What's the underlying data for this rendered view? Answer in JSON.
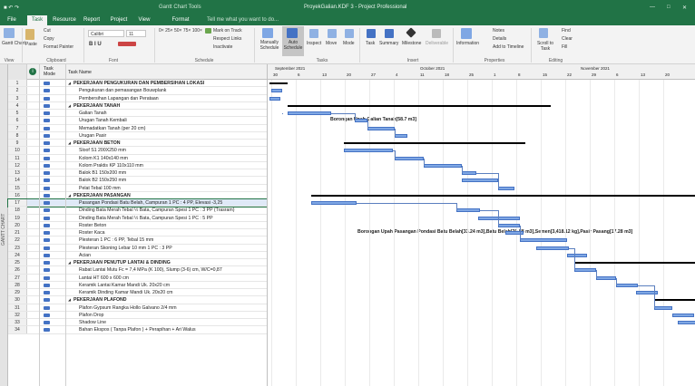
{
  "window": {
    "title": "ProyekGalian.KDF 3 - Project Professional",
    "context": "Gantt Chart Tools",
    "tell_me": "Tell me what you want to do..."
  },
  "tabs": [
    "File",
    "Task",
    "Resource",
    "Report",
    "Project",
    "View",
    "Format"
  ],
  "ribbon": {
    "view": {
      "gantt": "Gantt Chart",
      "group": "View"
    },
    "clipboard": {
      "paste": "Paste",
      "cut": "Cut",
      "copy": "Copy",
      "painter": "Format Painter",
      "group": "Clipboard"
    },
    "font": {
      "name": "Calibri",
      "size": "11",
      "group": "Font"
    },
    "schedule": {
      "track": "Mark on Track",
      "respect": "Respect Links",
      "inactivate": "Inactivate",
      "group": "Schedule"
    },
    "tasks": {
      "manual": "Manually Schedule",
      "auto": "Auto Schedule",
      "inspect": "Inspect",
      "move": "Move",
      "mode": "Mode",
      "group": "Tasks"
    },
    "insert": {
      "task": "Task",
      "summary": "Summary",
      "milestone": "Milestone",
      "deliverable": "Deliverable",
      "group": "Insert"
    },
    "properties": {
      "information": "Information",
      "notes": "Notes",
      "details": "Details",
      "timeline": "Add to Timeline",
      "group": "Properties"
    },
    "editing": {
      "scroll": "Scroll to Task",
      "find": "Find",
      "clear": "Clear",
      "fill": "Fill",
      "group": "Editing"
    }
  },
  "sidebar": {
    "label": "GANTT CHART"
  },
  "columns": {
    "mode": "Task Mode",
    "name": "Task Name"
  },
  "timescale": {
    "months": [
      "September 2021",
      "October 2021",
      "November 2021"
    ],
    "days": [
      "30",
      "6",
      "13",
      "20",
      "27",
      "4",
      "11",
      "18",
      "25",
      "1",
      "8",
      "15",
      "22",
      "29",
      "6",
      "13",
      "20"
    ]
  },
  "rows": [
    {
      "n": "1",
      "name": "PEKERJAAN PENGUKURAN DAN PEMBERSIHAN LOKASI",
      "sum": true
    },
    {
      "n": "2",
      "name": "Pengukuran dan pemasangan Bouwplank",
      "sum": false
    },
    {
      "n": "3",
      "name": "Pembersihan Lapangan dan Perataan",
      "sum": false
    },
    {
      "n": "4",
      "name": "PEKERJAAN TANAH",
      "sum": true
    },
    {
      "n": "5",
      "name": "Galian Tanah",
      "sum": false
    },
    {
      "n": "6",
      "name": "Urugan Tanah Kembali",
      "sum": false
    },
    {
      "n": "7",
      "name": "Memadatkan Tanah (per 20 cm)",
      "sum": false
    },
    {
      "n": "8",
      "name": "Urugan Pasir",
      "sum": false
    },
    {
      "n": "9",
      "name": "PEKERJAAN BETON",
      "sum": true
    },
    {
      "n": "10",
      "name": "Sloof S1 200X250 mm",
      "sum": false
    },
    {
      "n": "11",
      "name": "Kolom K1 140x140 mm",
      "sum": false
    },
    {
      "n": "12",
      "name": "Kolom Praktis KP 110x110 mm",
      "sum": false
    },
    {
      "n": "13",
      "name": "Balok B1 150x200 mm",
      "sum": false
    },
    {
      "n": "14",
      "name": "Balok B2 150x250 mm",
      "sum": false
    },
    {
      "n": "15",
      "name": "Pelat Tebal 100 mm",
      "sum": false
    },
    {
      "n": "16",
      "name": "PEKERJAAN PASANGAN",
      "sum": true
    },
    {
      "n": "17",
      "name": "Pasangan Pondasi Batu Belah, Campuran 1 PC : 4 PP, Elevasi -3,25",
      "sum": false
    },
    {
      "n": "18",
      "name": "Dinding Bata Merah Tebal ½ Bata, Campuran Spesi 1 PC : 3 PP (Trasram)",
      "sum": false
    },
    {
      "n": "19",
      "name": "Dinding Bata Merah Tebal ½ Bata, Campuran Spesi 1 PC : 5 PP",
      "sum": false
    },
    {
      "n": "20",
      "name": "Roster Beton",
      "sum": false
    },
    {
      "n": "21",
      "name": "Roster Kaca",
      "sum": false
    },
    {
      "n": "22",
      "name": "Plesteran 1 PC : 6 PP, Tebal 15 mm",
      "sum": false
    },
    {
      "n": "23",
      "name": "Plesteran Skoning Lebar 10 mm 1 PC : 3 PP",
      "sum": false
    },
    {
      "n": "24",
      "name": "Acian",
      "sum": false
    },
    {
      "n": "25",
      "name": "PEKERJAAN PENUTUP LANTAI & DINDING",
      "sum": true
    },
    {
      "n": "26",
      "name": "Rabat Lantai Mutu Fc = 7,4 MPa (K 100), Slump (3-6) cm, W/C=0,87",
      "sum": false
    },
    {
      "n": "27",
      "name": "Lantai HT 600 x 600 cm",
      "sum": false
    },
    {
      "n": "28",
      "name": "Keramik Lantai Kamar Mandi Uk. 20x20 cm",
      "sum": false
    },
    {
      "n": "29",
      "name": "Keramik Dinding Kamar Mandi Uk. 20x20 cm",
      "sum": false
    },
    {
      "n": "30",
      "name": "PEKERJAAN PLAFOND",
      "sum": true
    },
    {
      "n": "31",
      "name": "Plafon Gypsum Rangka Hollo Galvano 2/4 mm",
      "sum": false
    },
    {
      "n": "32",
      "name": "Plafon Drop",
      "sum": false
    },
    {
      "n": "33",
      "name": "Shadow Line",
      "sum": false
    },
    {
      "n": "34",
      "name": "Bahan Ekspos ( Tanpa Plafon ) + Perapihan + Ari Walus",
      "sum": false
    }
  ],
  "bar_labels": {
    "galian": "Borongan Upah Galian Tanah[58.7 m3]",
    "pondasi": "Borongan Upah Pasangan Pondasi Batu Belah[33.24 m3],Batu Belah[39.88 m3],Semen[3,418.12 kg],Pasir Pasang[17.28 m3]"
  }
}
